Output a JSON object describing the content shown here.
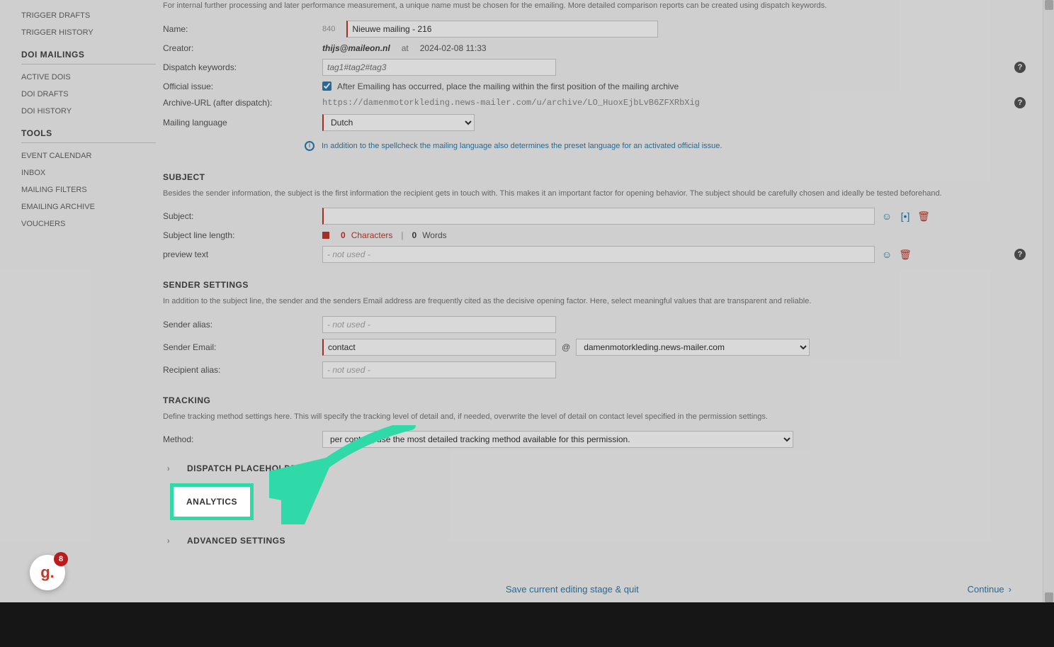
{
  "sidebar": {
    "trigger_drafts": "TRIGGER DRAFTS",
    "trigger_history": "TRIGGER HISTORY",
    "doi_title": "DOI MAILINGS",
    "active_dois": "ACTIVE DOIS",
    "doi_drafts": "DOI DRAFTS",
    "doi_history": "DOI HISTORY",
    "tools_title": "TOOLS",
    "event_calendar": "EVENT CALENDAR",
    "inbox": "INBOX",
    "mailing_filters": "MAILING FILTERS",
    "emailing_archive": "EMAILING ARCHIVE",
    "vouchers": "VOUCHERS"
  },
  "intro": "For internal further processing and later performance measurement, a unique name must be chosen for the emailing. More detailed comparison reports can be created using dispatch keywords.",
  "fields": {
    "name_label": "Name:",
    "name_counter": "840",
    "name_value": "Nieuwe mailing - 216",
    "creator_label": "Creator:",
    "creator_email": "thijs@maileon.nl",
    "creator_at": "at",
    "creator_ts": "2024-02-08 11:33",
    "dispatch_label": "Dispatch keywords:",
    "dispatch_ph": "tag1#tag2#tag3",
    "official_label": "Official issue:",
    "official_text": "After Emailing has occurred, place the mailing within the first position of the mailing archive",
    "archive_label": "Archive-URL (after dispatch):",
    "archive_url": "https://damenmotorkleding.news-mailer.com/u/archive/LO_HuoxEjbLvB6ZFXRbXig",
    "lang_label": "Mailing language",
    "lang_value": "Dutch",
    "lang_info": "In addition to the spellcheck the mailing language also determines the preset language for an activated official issue."
  },
  "subject": {
    "title": "SUBJECT",
    "desc": "Besides the sender information, the subject is the first information the recipient gets in touch with. This makes it an important factor for opening behavior. The subject should be carefully chosen and ideally be tested beforehand.",
    "label": "Subject:",
    "len_label": "Subject line length:",
    "chars_n": "0",
    "chars_w": "Characters",
    "words_n": "0",
    "words_w": "Words",
    "preview_label": "preview text",
    "preview_ph": "- not used -"
  },
  "sender": {
    "title": "SENDER SETTINGS",
    "desc": "In addition to the subject line, the sender and the senders Email address are frequently cited as the decisive opening factor. Here, select meaningful values that are transparent and reliable.",
    "alias_label": "Sender alias:",
    "alias_ph": "- not used -",
    "email_label": "Sender Email:",
    "email_value": "contact",
    "at": "@",
    "domain": "damenmotorkleding.news-mailer.com",
    "recip_label": "Recipient alias:",
    "recip_ph": "- not used -"
  },
  "tracking": {
    "title": "TRACKING",
    "desc": "Define tracking method settings here. This will specify the tracking level of detail and, if needed, overwrite the level of detail on contact level specified in the permission settings.",
    "method_label": "Method:",
    "method_value": "per contact, use the most detailed tracking method available for this permission."
  },
  "accordions": {
    "dispatch": "DISPATCH PLACEHOLDERS",
    "analytics": "ANALYTICS",
    "advanced": "ADVANCED SETTINGS"
  },
  "footer": {
    "save": "Save current editing stage & quit",
    "continue": "Continue"
  },
  "floater_badge": "8"
}
